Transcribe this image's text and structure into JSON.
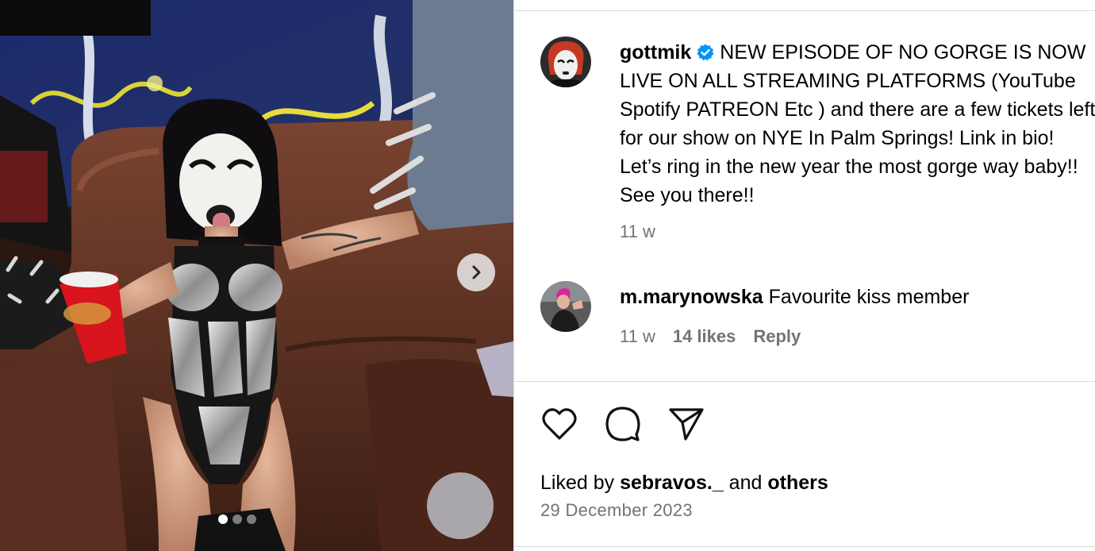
{
  "post": {
    "author": "gottmik",
    "verified_icon": "verified-badge-icon",
    "caption": "NEW EPISODE OF NO GORGE IS NOW LIVE ON ALL STREAMING PLATFORMS (YouTube Spotify PATREON Etc ) and there are a few tickets left for our show on NYE In Palm Springs! Link in bio! Let’s ring in the new year the most gorge way baby!! See you there!!",
    "age": "11 w",
    "carousel": {
      "current": 1,
      "total": 3
    }
  },
  "comments": [
    {
      "author": "m.marynowska",
      "text": "Favourite kiss member",
      "age": "11 w",
      "likes": "14 likes",
      "reply_label": "Reply"
    }
  ],
  "actions": {
    "like_icon": "heart-icon",
    "comment_icon": "comment-bubble-icon",
    "share_icon": "paper-plane-icon"
  },
  "likes": {
    "prefix": "Liked by",
    "user": "sebravos._",
    "joiner": "and",
    "others": "others"
  },
  "date": "29 December 2023",
  "colors": {
    "verified": "#0095f6",
    "secondary_text": "#737373",
    "divider": "#dbdbdb"
  }
}
